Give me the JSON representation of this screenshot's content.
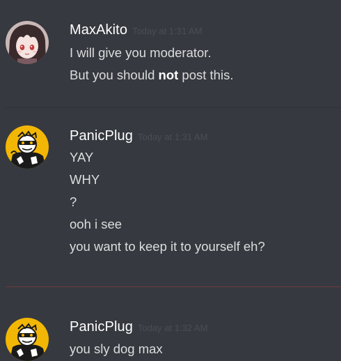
{
  "messages": [
    {
      "username": "MaxAkito",
      "timestamp": "Today at 1:31 AM",
      "avatar": "anime-girl-avatar",
      "lines": [
        {
          "text": "I will give you moderator."
        },
        {
          "before": "But you should ",
          "bold": "not",
          "after": " post this."
        }
      ]
    },
    {
      "username": "PanicPlug",
      "timestamp": "Today at 1:31 AM",
      "avatar": "yellow-masked-avatar",
      "lines": [
        {
          "text": "YAY"
        },
        {
          "text": "WHY"
        },
        {
          "text": "?"
        },
        {
          "text": "ooh i see"
        },
        {
          "text": "you want to keep it to yourself eh?"
        }
      ]
    },
    {
      "username": "PanicPlug",
      "timestamp": "Today at 1:32 AM",
      "avatar": "yellow-masked-avatar",
      "lines": [
        {
          "text": "you sly dog max"
        }
      ]
    }
  ],
  "colors": {
    "background": "#36393f",
    "username": "#ffffff",
    "message_text": "#dcddde",
    "timestamp": "#4b4e54",
    "new_messages_divider": "#6f3a3d"
  }
}
